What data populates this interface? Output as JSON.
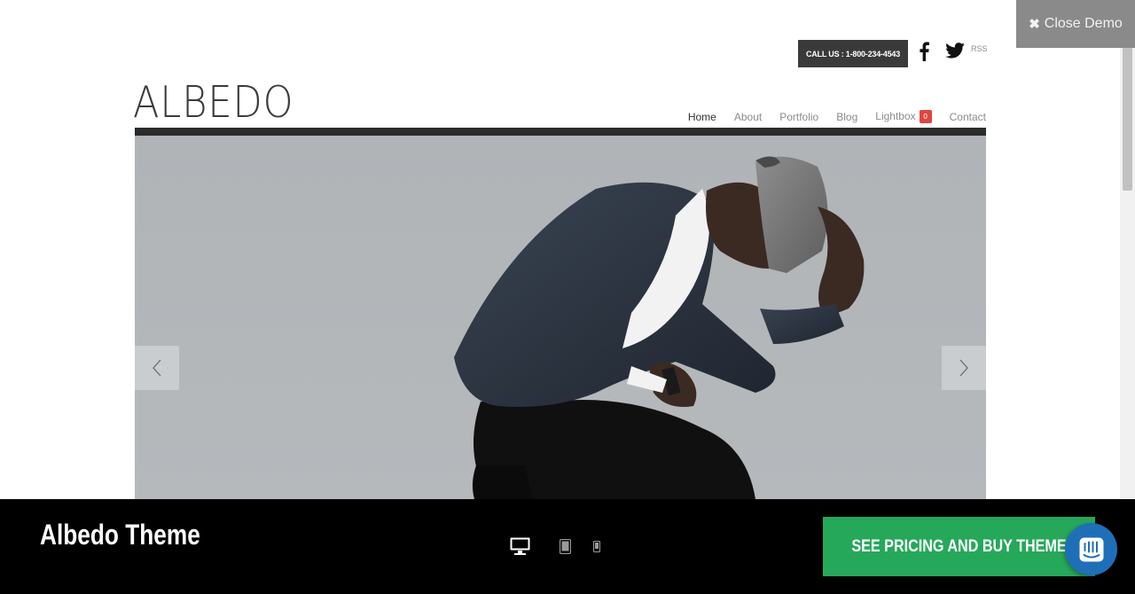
{
  "demo_bar": {
    "close_label": "Close Demo",
    "close_icon": "close-icon"
  },
  "header": {
    "call_us": "CALL US : 1-800-234-4543",
    "social": {
      "facebook_icon": "facebook-icon",
      "twitter_icon": "twitter-icon",
      "rss_label": "RSS"
    },
    "logo": "ALBEDO",
    "nav": [
      {
        "label": "Home",
        "active": true
      },
      {
        "label": "About"
      },
      {
        "label": "Portfolio"
      },
      {
        "label": "Blog"
      },
      {
        "label": "Lightbox",
        "badge": "0"
      },
      {
        "label": "Contact"
      }
    ]
  },
  "slider": {
    "prev_icon": "chevron-left-icon",
    "next_icon": "chevron-right-icon",
    "background_color": "#b2b6b9"
  },
  "bottom_bar": {
    "title": "Albedo Theme",
    "devices": [
      "desktop-icon",
      "tablet-icon",
      "mobile-icon"
    ],
    "buy_label": "SEE PRICING AND BUY THEME",
    "buy_color": "#26a85a",
    "chat_icon": "chat-icon",
    "chat_color": "#1f6fb8"
  }
}
